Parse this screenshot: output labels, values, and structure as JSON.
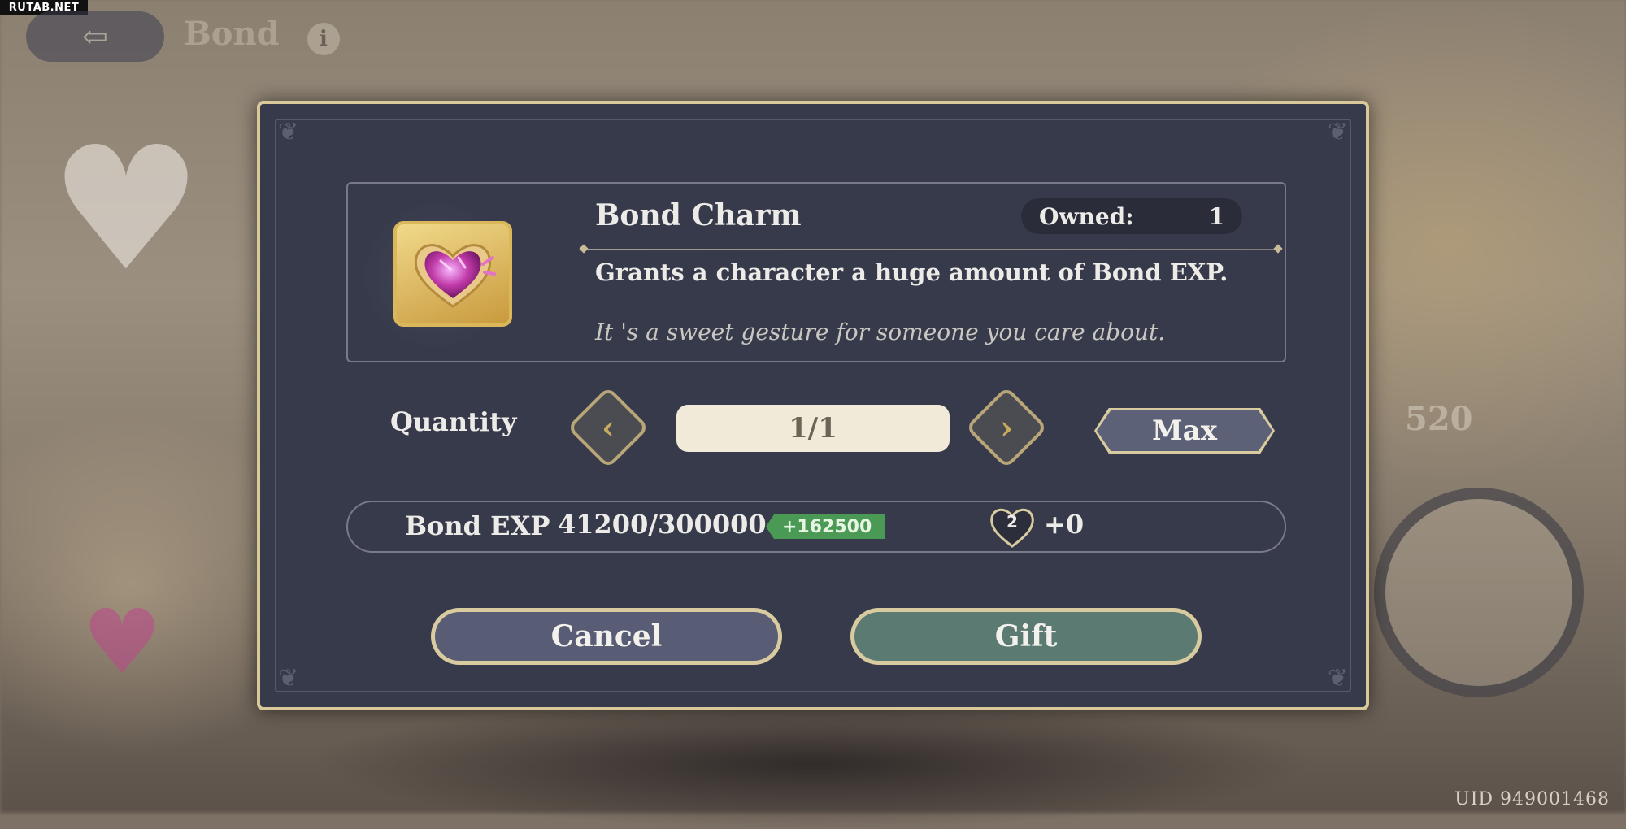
{
  "watermark": "RUTAB.NET",
  "header": {
    "back_icon": "back-arrow-icon",
    "title": "Bond",
    "info_icon": "i"
  },
  "background": {
    "stat_number": "520",
    "uid": "UID 949001468"
  },
  "dialog": {
    "item": {
      "icon": "heart-gem-icon",
      "name": "Bond Charm",
      "owned_label": "Owned:",
      "owned_count": "1",
      "description": "Grants a character a huge amount of Bond EXP.",
      "flavor": "It 's a sweet gesture for someone you care about."
    },
    "quantity": {
      "label": "Quantity",
      "value": "1/1",
      "max_label": "Max"
    },
    "exp": {
      "label": "Bond EXP",
      "value": "41200/300000",
      "gain": "+162500",
      "level": "2",
      "level_gain": "+0"
    },
    "buttons": {
      "cancel": "Cancel",
      "gift": "Gift"
    }
  },
  "colors": {
    "dialog_bg": "#373a4a",
    "gold_border": "#d8c89a",
    "exp_gain": "#4a9a56",
    "gift_button": "#5a7a72",
    "cancel_button": "#585c74"
  }
}
